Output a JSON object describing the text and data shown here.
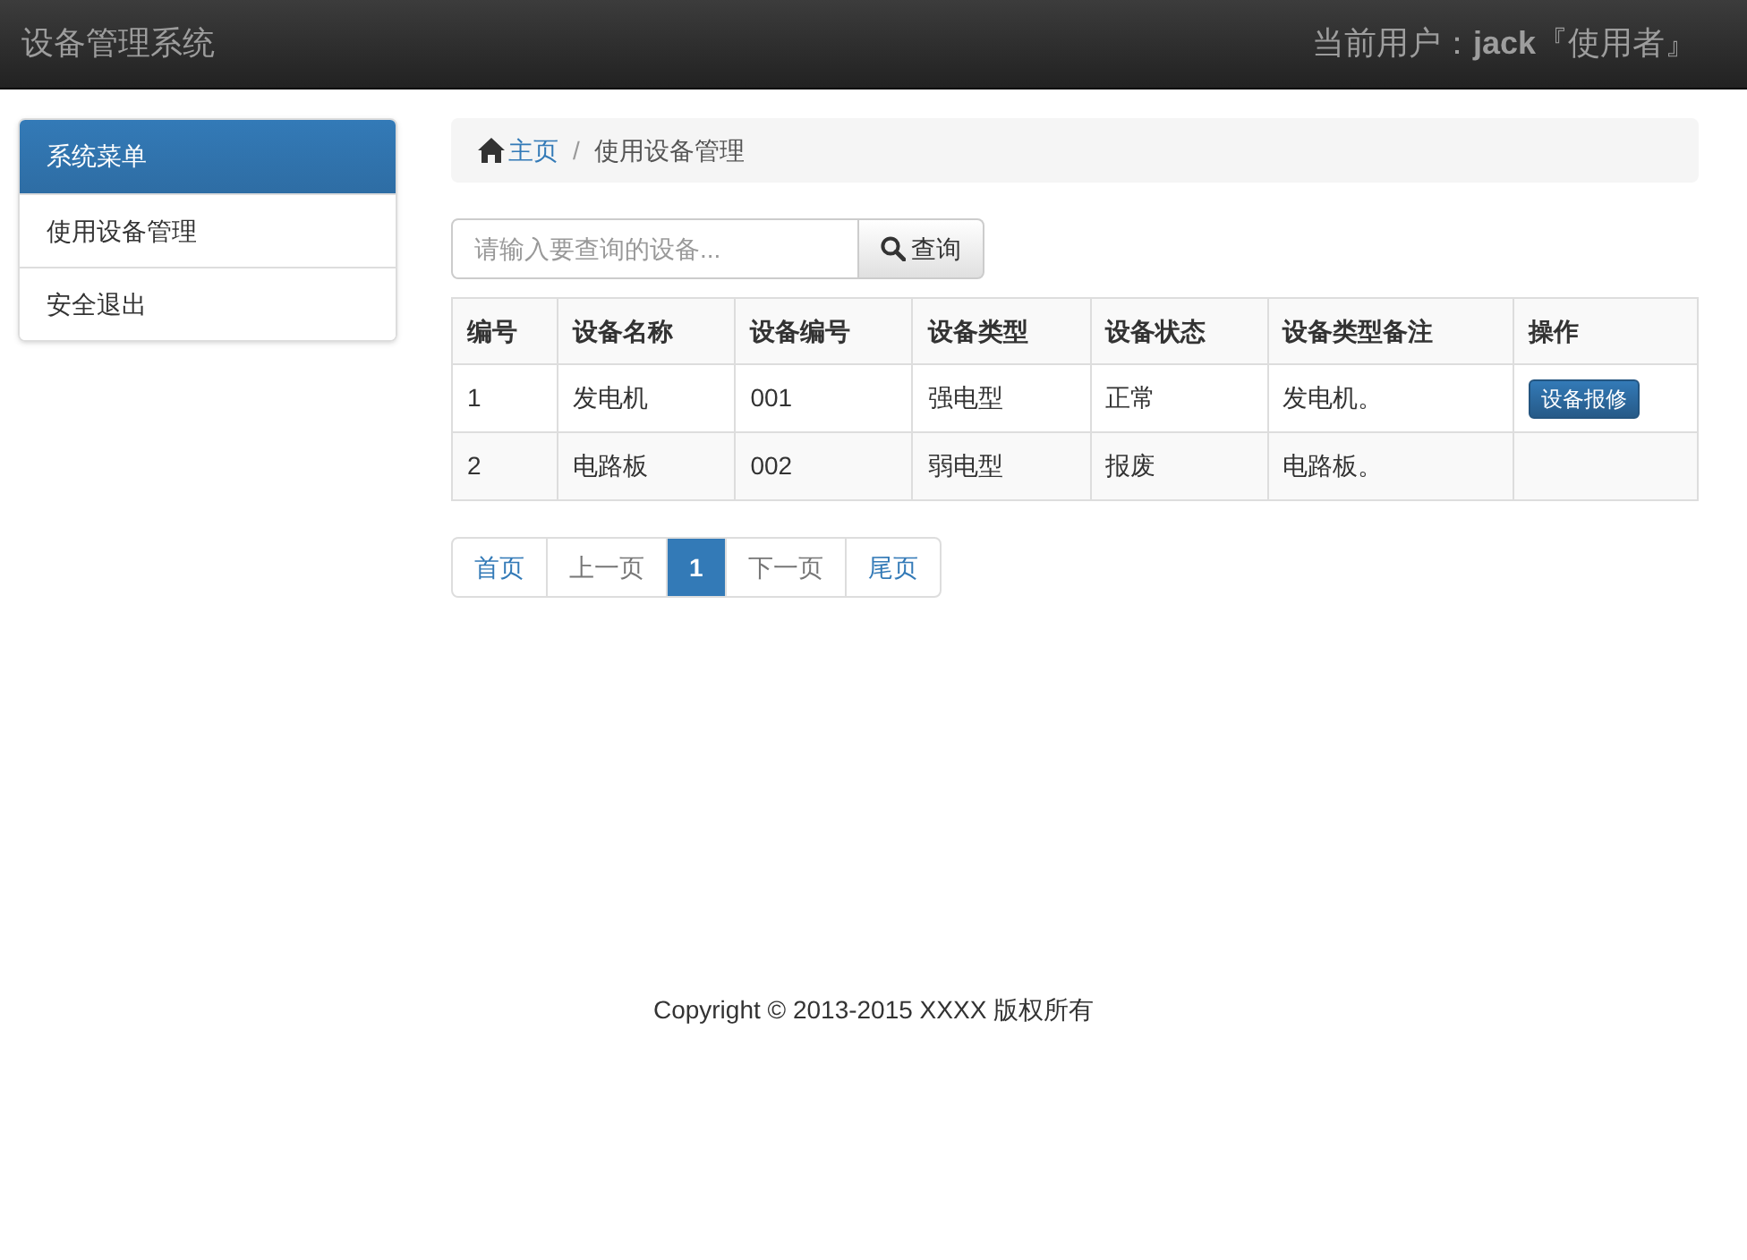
{
  "navbar": {
    "brand": "设备管理系统",
    "user": "当前用户：**jack**『使用者』"
  },
  "sidebar": {
    "title": "系统菜单",
    "items": [
      {
        "label": "使用设备管理"
      },
      {
        "label": "安全退出"
      }
    ]
  },
  "breadcrumb": [
    {
      "label": "主页",
      "kind": "home"
    },
    {
      "label": "/",
      "kind": "separator"
    },
    {
      "label": "使用设备管理",
      "kind": "current"
    }
  ],
  "search": {
    "placeholder": "请输入要查询的设备...",
    "button": "查询"
  },
  "table": {
    "columns": [
      "编号",
      "设备名称",
      "设备编号",
      "设备类型",
      "设备状态",
      "设备类型备注",
      "操作"
    ],
    "rows": [
      {
        "cells": [
          "1",
          "发电机",
          "001",
          "强电型",
          "正常",
          "发电机。"
        ],
        "action": "设备报修"
      },
      {
        "cells": [
          "2",
          "电路板",
          "002",
          "弱电型",
          "报废",
          "电路板。"
        ]
      }
    ]
  },
  "pagination": [
    {
      "label": "首页",
      "disabled": false,
      "selected": false
    },
    {
      "label": "上一页",
      "disabled": true,
      "selected": false
    },
    {
      "label": "1",
      "disabled": false,
      "selected": true
    },
    {
      "label": "下一页",
      "disabled": true,
      "selected": false
    },
    {
      "label": "尾页",
      "disabled": false,
      "selected": false
    }
  ],
  "footer": "Copyright © 2013-2015 XXXX 版权所有"
}
